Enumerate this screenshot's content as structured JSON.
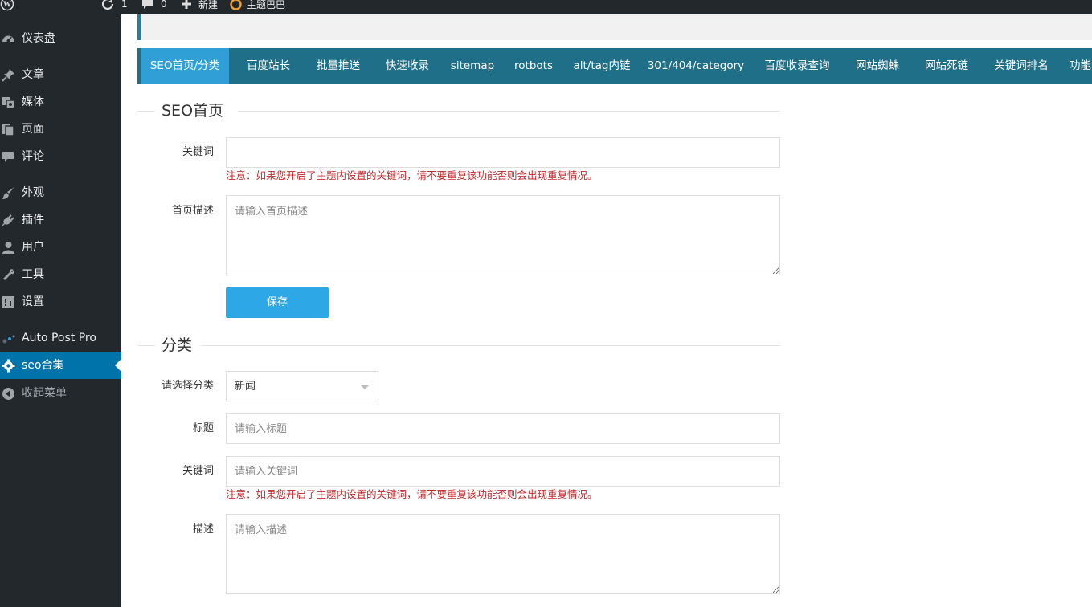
{
  "adminbar": {
    "updates_count": "1",
    "comments_count": "0",
    "new_label": "新建",
    "site_label": "主题巴巴"
  },
  "sidebar": {
    "items": [
      {
        "label": "仪表盘",
        "icon": "dashboard-icon"
      },
      {
        "label": "文章",
        "icon": "pin-icon"
      },
      {
        "label": "媒体",
        "icon": "media-icon"
      },
      {
        "label": "页面",
        "icon": "page-icon"
      },
      {
        "label": "评论",
        "icon": "comment-icon"
      },
      {
        "label": "外观",
        "icon": "brush-icon"
      },
      {
        "label": "插件",
        "icon": "plugin-icon"
      },
      {
        "label": "用户",
        "icon": "user-icon"
      },
      {
        "label": "工具",
        "icon": "wrench-icon"
      },
      {
        "label": "设置",
        "icon": "settings-icon"
      },
      {
        "label": "Auto Post Pro",
        "icon": "auto-post-icon"
      },
      {
        "label": "seo合集",
        "icon": "gear-icon",
        "current": true
      },
      {
        "label": "收起菜单",
        "icon": "collapse-icon"
      }
    ]
  },
  "tabs": [
    {
      "label": "SEO首页/分类",
      "active": true
    },
    {
      "label": "百度站长"
    },
    {
      "label": "批量推送"
    },
    {
      "label": "快速收录"
    },
    {
      "label": "sitemap"
    },
    {
      "label": "rotbots"
    },
    {
      "label": "alt/tag内链"
    },
    {
      "label": "301/404/category"
    },
    {
      "label": "百度收录查询"
    },
    {
      "label": "网站蜘蛛"
    },
    {
      "label": "网站死链"
    },
    {
      "label": "关键词排名"
    },
    {
      "label": "功能"
    }
  ],
  "seo_home": {
    "title": "SEO首页",
    "keywords_label": "关键词",
    "keywords_value": "",
    "notice": "注意：如果您开启了主题内设置的关键词，请不要重复该功能否则会出现重复情况。",
    "description_label": "首页描述",
    "description_placeholder": "请输入首页描述",
    "save_label": "保存"
  },
  "category": {
    "title": "分类",
    "select_label": "请选择分类",
    "select_value": "新闻",
    "title_label": "标题",
    "title_placeholder": "请输入标题",
    "keywords_label": "关键词",
    "keywords_placeholder": "请输入关键词",
    "notice": "注意：如果您开启了主题内设置的关键词，请不要重复该功能否则会出现重复情况。",
    "description_label": "描述",
    "description_placeholder": "请输入描述"
  },
  "colors": {
    "sidebar_bg": "#23282d",
    "current_menu": "#0073aa",
    "tabbar_bg": "#1f6f89",
    "active_tab": "#2f9fd5",
    "save_button": "#2ea7e6",
    "notice_text": "#c4282a"
  }
}
